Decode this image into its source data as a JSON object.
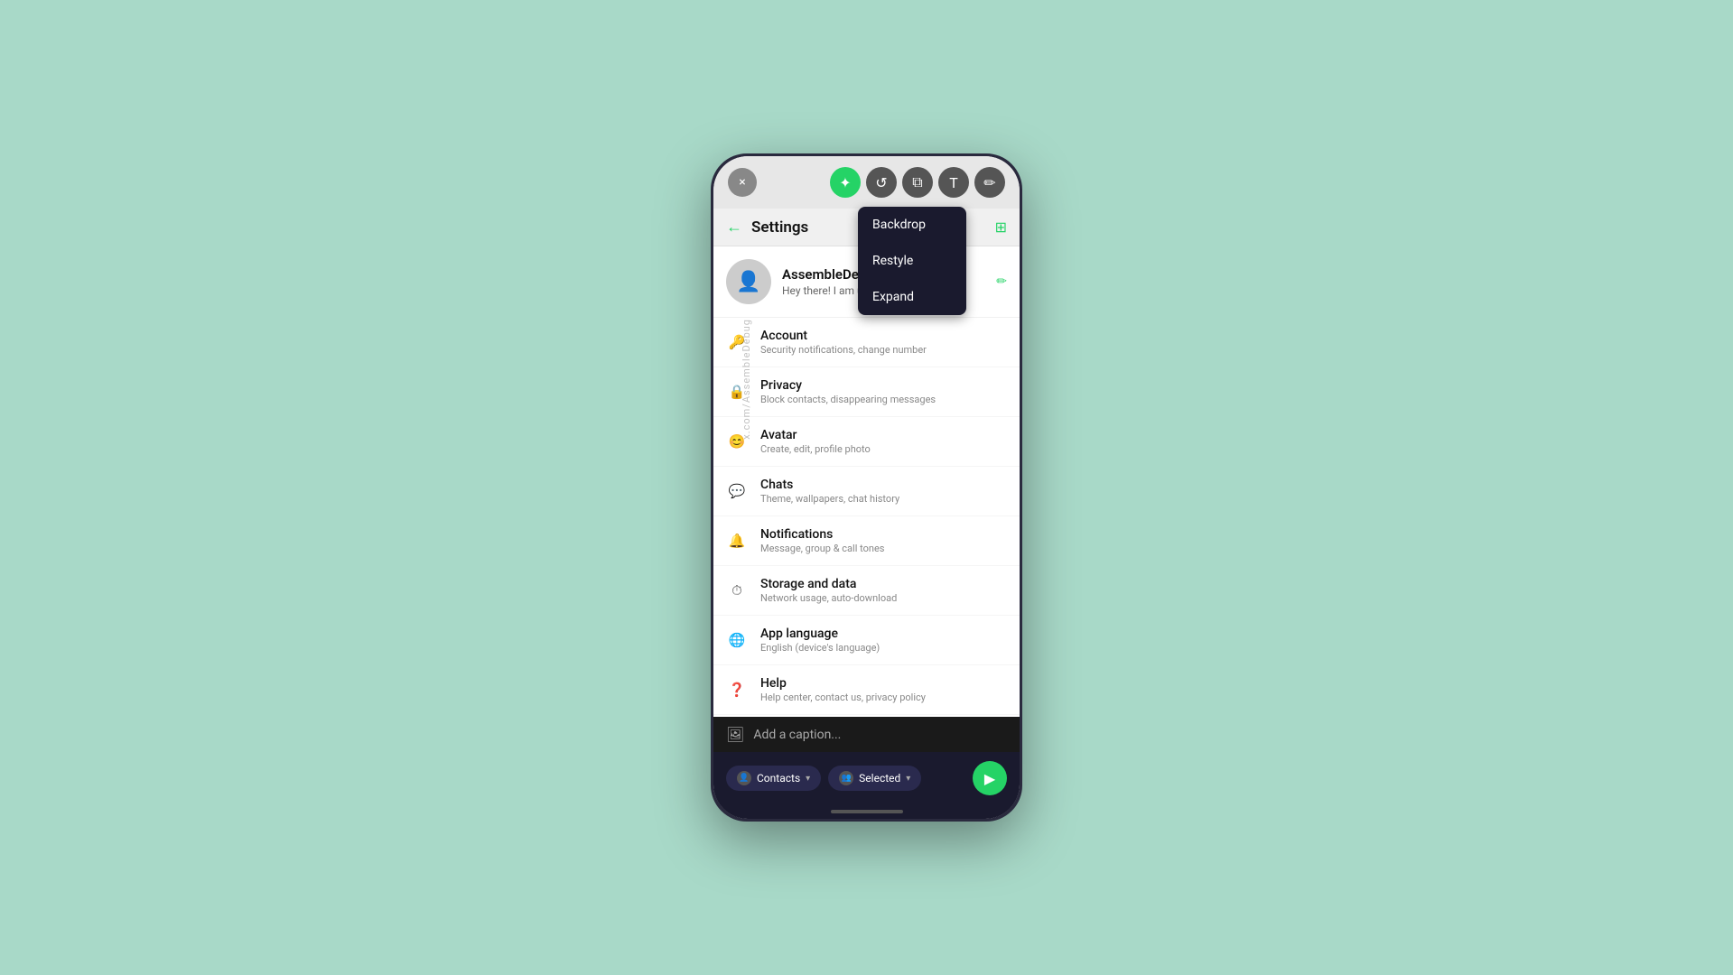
{
  "background": {
    "color": "#a8d9c8"
  },
  "phone": {
    "watermark": "x.com/AssembleDebug"
  },
  "toolbar": {
    "close_icon": "×",
    "icons": [
      {
        "id": "cursor-icon",
        "symbol": "☞",
        "style": "green"
      },
      {
        "id": "refresh-icon",
        "symbol": "↺",
        "style": "dark"
      },
      {
        "id": "copy-icon",
        "symbol": "⧉",
        "style": "dark"
      },
      {
        "id": "text-icon",
        "symbol": "T",
        "style": "dark"
      },
      {
        "id": "edit-icon",
        "symbol": "✏",
        "style": "dark"
      }
    ]
  },
  "dropdown": {
    "items": [
      {
        "label": "Backdrop"
      },
      {
        "label": "Restyle"
      },
      {
        "label": "Expand"
      }
    ]
  },
  "settings": {
    "header_title": "Settings",
    "profile": {
      "name": "AssembleDebug",
      "status": "Hey there! I am using WhatsApp."
    },
    "items": [
      {
        "id": "account",
        "icon": "key",
        "title": "Account",
        "subtitle": "Security notifications, change number"
      },
      {
        "id": "privacy",
        "icon": "lock",
        "title": "Privacy",
        "subtitle": "Block contacts, disappearing messages"
      },
      {
        "id": "avatar",
        "icon": "face",
        "title": "Avatar",
        "subtitle": "Create, edit, profile photo"
      },
      {
        "id": "chats",
        "icon": "chat",
        "title": "Chats",
        "subtitle": "Theme, wallpapers, chat history"
      },
      {
        "id": "notifications",
        "icon": "bell",
        "title": "Notifications",
        "subtitle": "Message, group & call tones"
      },
      {
        "id": "storage",
        "icon": "storage",
        "title": "Storage and data",
        "subtitle": "Network usage, auto-download"
      },
      {
        "id": "language",
        "icon": "globe",
        "title": "App language",
        "subtitle": "English (device's language)"
      },
      {
        "id": "help",
        "icon": "help",
        "title": "Help",
        "subtitle": "Help center, contact us, privacy policy"
      }
    ]
  },
  "caption": {
    "placeholder": "Add a caption..."
  },
  "bottom_bar": {
    "contacts_label": "Contacts",
    "selected_label": "Selected",
    "send_icon": "▶"
  }
}
